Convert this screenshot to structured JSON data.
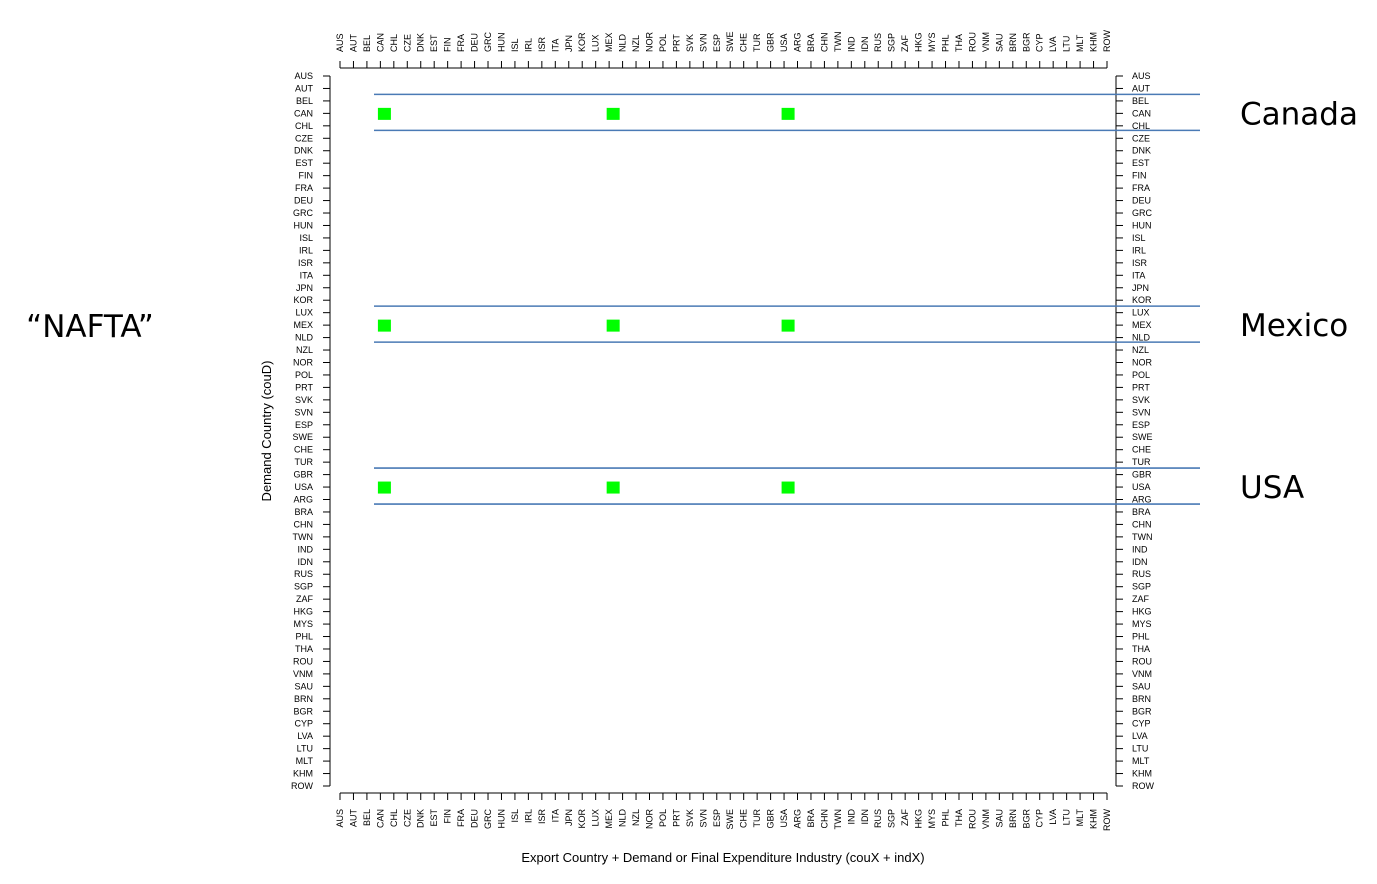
{
  "chart_data": {
    "type": "heatmap",
    "title": "",
    "xlabel": "Export Country + Demand or Final Expenditure Industry (couX + indX)",
    "ylabel": "Demand Country (couD)",
    "x_categories": [
      "AUS",
      "AUT",
      "BEL",
      "CAN",
      "CHL",
      "CZE",
      "DNK",
      "EST",
      "FIN",
      "FRA",
      "DEU",
      "GRC",
      "HUN",
      "ISL",
      "IRL",
      "ISR",
      "ITA",
      "JPN",
      "KOR",
      "LUX",
      "MEX",
      "NLD",
      "NZL",
      "NOR",
      "POL",
      "PRT",
      "SVK",
      "SVN",
      "ESP",
      "SWE",
      "CHE",
      "TUR",
      "GBR",
      "USA",
      "ARG",
      "BRA",
      "CHN",
      "TWN",
      "IND",
      "IDN",
      "RUS",
      "SGP",
      "ZAF",
      "HKG",
      "MYS",
      "PHL",
      "THA",
      "ROU",
      "VNM",
      "SAU",
      "BRN",
      "BGR",
      "CYP",
      "LVA",
      "LTU",
      "MLT",
      "KHM",
      "ROW"
    ],
    "y_categories": [
      "AUS",
      "AUT",
      "BEL",
      "CAN",
      "CHL",
      "CZE",
      "DNK",
      "EST",
      "FIN",
      "FRA",
      "DEU",
      "GRC",
      "HUN",
      "ISL",
      "IRL",
      "ISR",
      "ITA",
      "JPN",
      "KOR",
      "LUX",
      "MEX",
      "NLD",
      "NZL",
      "NOR",
      "POL",
      "PRT",
      "SVK",
      "SVN",
      "ESP",
      "SWE",
      "CHE",
      "TUR",
      "GBR",
      "USA",
      "ARG",
      "BRA",
      "CHN",
      "TWN",
      "IND",
      "IDN",
      "RUS",
      "SGP",
      "ZAF",
      "HKG",
      "MYS",
      "PHL",
      "THA",
      "ROU",
      "VNM",
      "SAU",
      "BRN",
      "BGR",
      "CYP",
      "LVA",
      "LTU",
      "MLT",
      "KHM",
      "ROW"
    ],
    "cells": [
      {
        "x": "CAN",
        "y": "CAN",
        "value": 1
      },
      {
        "x": "MEX",
        "y": "CAN",
        "value": 1
      },
      {
        "x": "USA",
        "y": "CAN",
        "value": 1
      },
      {
        "x": "CAN",
        "y": "MEX",
        "value": 1
      },
      {
        "x": "MEX",
        "y": "MEX",
        "value": 1
      },
      {
        "x": "USA",
        "y": "MEX",
        "value": 1
      },
      {
        "x": "CAN",
        "y": "USA",
        "value": 1
      },
      {
        "x": "MEX",
        "y": "USA",
        "value": 1
      },
      {
        "x": "USA",
        "y": "USA",
        "value": 1
      }
    ],
    "cell_color": "#00ff00",
    "grid": false,
    "highlight_bands": [
      {
        "label": "Canada",
        "row": "CAN"
      },
      {
        "label": "Mexico",
        "row": "MEX"
      },
      {
        "label": "USA",
        "row": "USA"
      }
    ],
    "band_color": "#4a7ab5",
    "group_annotation": "“NAFTA”"
  }
}
